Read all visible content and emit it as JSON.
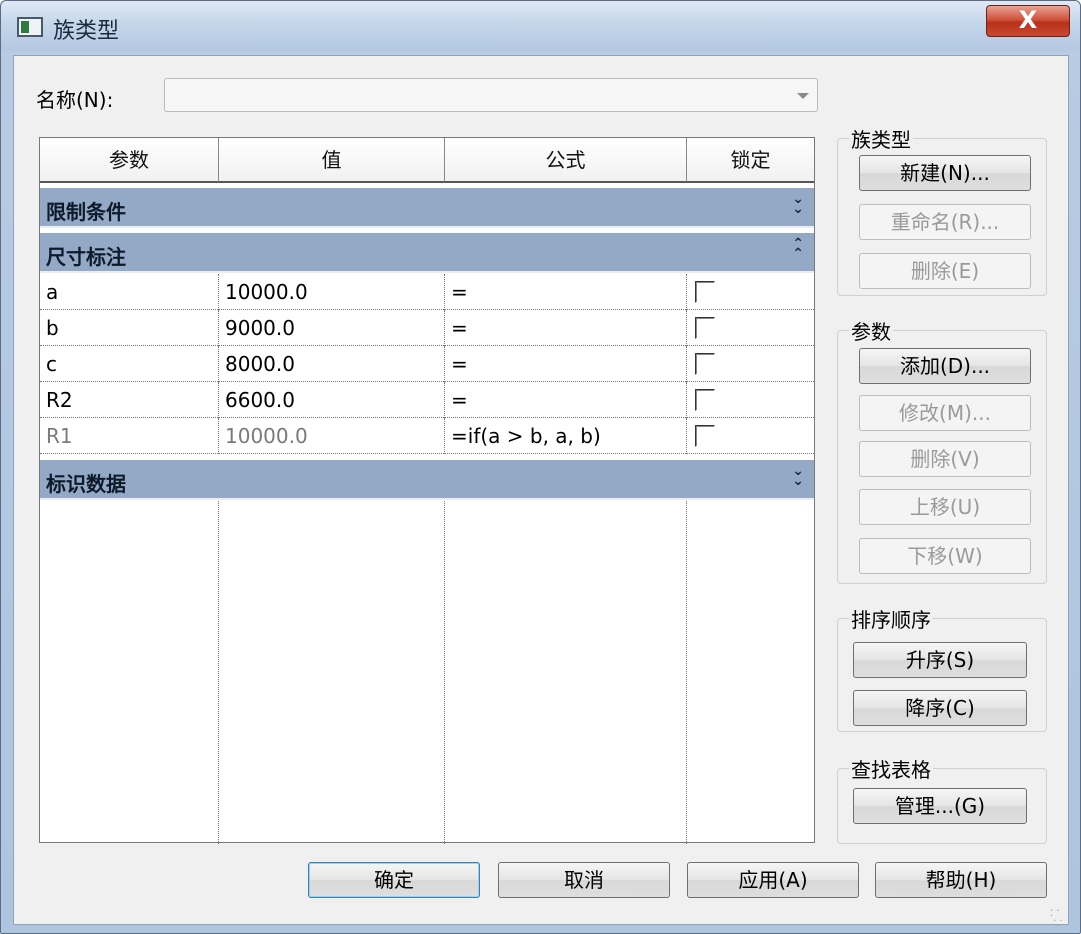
{
  "window": {
    "title": "族类型",
    "close_label": "X"
  },
  "name_field": {
    "label": "名称(N):",
    "value": ""
  },
  "table": {
    "headers": [
      "参数",
      "值",
      "公式",
      "锁定"
    ],
    "groups": [
      {
        "label": "限制条件",
        "chevron": "collapse"
      },
      {
        "label": "尺寸标注",
        "chevron": "expand"
      },
      {
        "label": "标识数据",
        "chevron": "collapse"
      }
    ],
    "rows": [
      {
        "param": "a",
        "value": "10000.0",
        "formula": "=",
        "locked": false
      },
      {
        "param": "b",
        "value": "9000.0",
        "formula": "=",
        "locked": false
      },
      {
        "param": "c",
        "value": "8000.0",
        "formula": "=",
        "locked": false
      },
      {
        "param": "R2",
        "value": "6600.0",
        "formula": "=",
        "locked": false
      },
      {
        "param": "R1",
        "value": "10000.0",
        "formula": "=if(a > b, a, b)",
        "locked": false
      }
    ]
  },
  "family_types": {
    "title": "族类型",
    "new": "新建(N)...",
    "rename": "重命名(R)...",
    "delete": "删除(E)"
  },
  "parameters": {
    "title": "参数",
    "add": "添加(D)...",
    "modify": "修改(M)...",
    "delete": "删除(V)",
    "move_up": "上移(U)",
    "move_down": "下移(W)"
  },
  "sort_order": {
    "title": "排序顺序",
    "ascending": "升序(S)",
    "descending": "降序(C)"
  },
  "lookup_tables": {
    "title": "查找表格",
    "manage": "管理...(G)"
  },
  "footer": {
    "ok": "确定",
    "cancel": "取消",
    "apply": "应用(A)",
    "help": "帮助(H)"
  }
}
